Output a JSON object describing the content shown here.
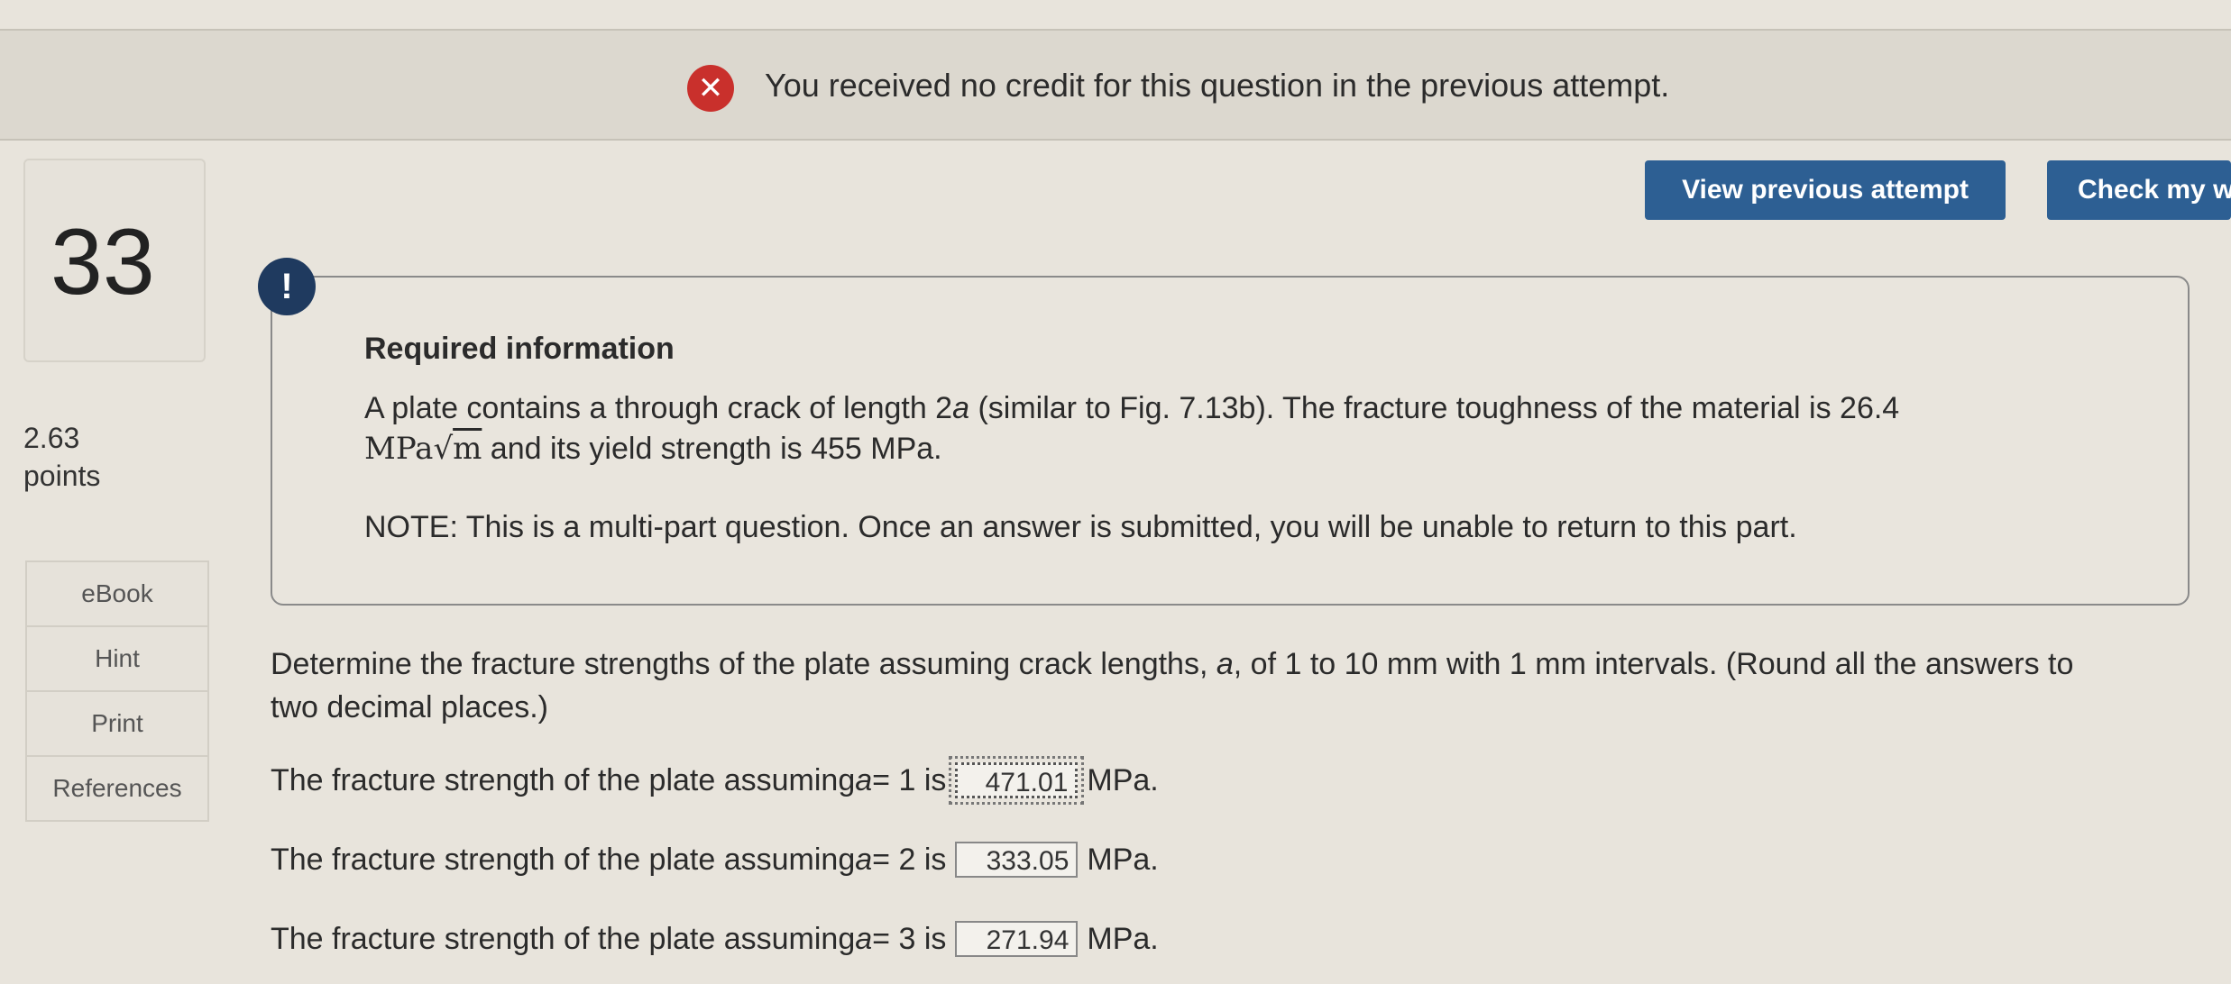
{
  "banner": {
    "icon": "x-icon",
    "message": "You received no credit for this question in the previous attempt."
  },
  "question": {
    "number": "33",
    "points_value": "2.63",
    "points_label": "points"
  },
  "side_nav": {
    "items": [
      {
        "label": "eBook"
      },
      {
        "label": "Hint"
      },
      {
        "label": "Print"
      },
      {
        "label": "References"
      }
    ]
  },
  "toolbar": {
    "view_previous_label": "View previous attempt",
    "check_label": "Check my w"
  },
  "info": {
    "icon": "exclamation-icon",
    "title": "Required information",
    "line1": "A plate contains a through crack of length 2",
    "line1_var": "a",
    "line1_rest": " (similar to Fig. 7.13b). The fracture toughness of the material is 26.4",
    "line2_unit": "MPa",
    "line2_sqrt": "m",
    "line2_rest": " and its yield strength is 455 MPa.",
    "note": "NOTE: This is a multi-part question. Once an answer is submitted, you will be unable to return to this part."
  },
  "prompt": {
    "line1_a": "Determine the fracture strengths of the plate assuming crack lengths, ",
    "line1_var": "a",
    "line1_b": ", of 1 to 10 mm with 1 mm intervals. (Round all the answers to",
    "line2": "two decimal places.)"
  },
  "answers": [
    {
      "prefix": "The fracture strength of the plate assuming ",
      "var": "a",
      "eq": " = 1 is",
      "value": "471.01",
      "unit": "MPa."
    },
    {
      "prefix": "The fracture strength of the plate assuming ",
      "var": "a",
      "eq": " = 2 is",
      "value": "333.05",
      "unit": "MPa."
    },
    {
      "prefix": "The fracture strength of the plate assuming ",
      "var": "a",
      "eq": " = 3 is",
      "value": "271.94",
      "unit": "MPa."
    }
  ],
  "colors": {
    "error_red": "#c9302c",
    "button_blue": "#2d5f93",
    "info_icon_navy": "#1f3a5f"
  }
}
